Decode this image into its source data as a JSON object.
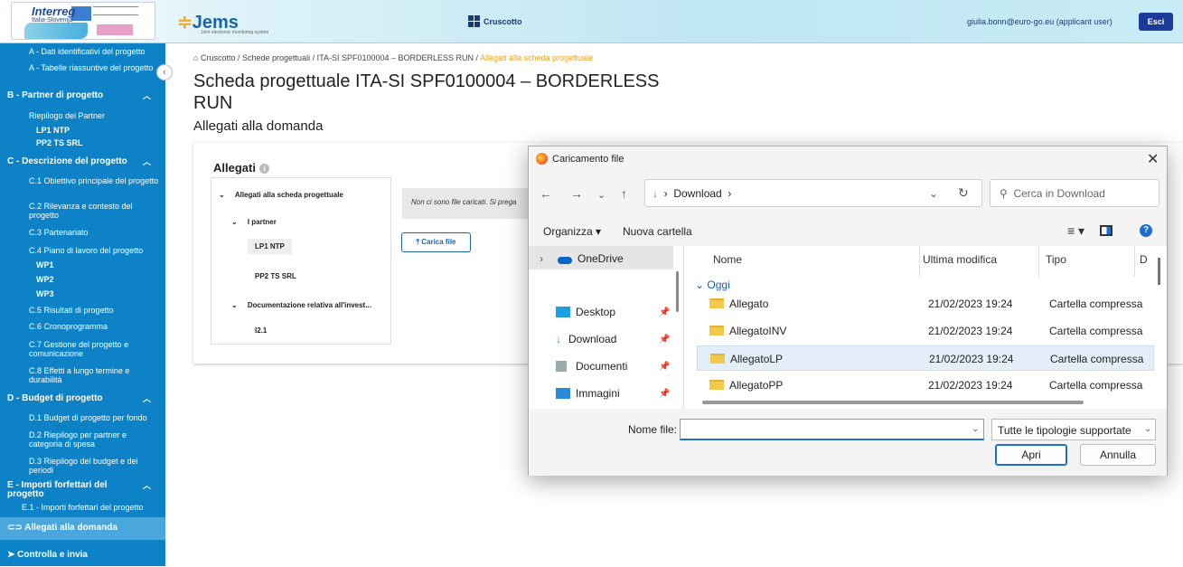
{
  "header": {
    "logo_text": "Interreg",
    "logo_sub": "Italia-Slovenija",
    "app_name": "Jems",
    "app_sub": "Joint electronic monitoring system",
    "dashboard_label": "Cruscotto",
    "user": "giulia.bonn@euro-go.eu (applicant user)",
    "logout": "Esci"
  },
  "sidebar": {
    "items": [
      {
        "label": "A - Dati identificativi del progetto"
      },
      {
        "label": "A - Tabelle riassuntive del progetto"
      },
      {
        "label": "B - Partner di progetto"
      },
      {
        "label": "Riepilogo dei Partner"
      },
      {
        "label": "LP1 NTP"
      },
      {
        "label": "PP2 TS SRL"
      },
      {
        "label": "C - Descrizione del progetto"
      },
      {
        "label": "C.1 Obiettivo principale del progetto"
      },
      {
        "label": "C.2 Rilevanza e contesto del progetto"
      },
      {
        "label": "C.3 Partenariato"
      },
      {
        "label": "C.4 Piano di lavoro del progetto"
      },
      {
        "label": "WP1"
      },
      {
        "label": "WP2"
      },
      {
        "label": "WP3"
      },
      {
        "label": "C.5 Risultati di progetto"
      },
      {
        "label": "C.6 Cronoprogramma"
      },
      {
        "label": "C.7 Gestione del progetto e comunicazione"
      },
      {
        "label": "C.8 Effetti a lungo termine e durabilità"
      },
      {
        "label": "D - Budget di progetto"
      },
      {
        "label": "D.1 Budget di progetto per fondo"
      },
      {
        "label": "D.2 Riepilogo per partner e categoria di spesa"
      },
      {
        "label": "D.3 Riepilogo del budget e dei periodi"
      },
      {
        "label": "E - Importi forfettari del progetto"
      },
      {
        "label": "E.1 - Importi forfettari del progetto"
      },
      {
        "label": "Allegati alla domanda"
      },
      {
        "label": "Controlla e invia"
      }
    ]
  },
  "breadcrumb": {
    "home": "Cruscotto",
    "sep": "/",
    "b2": "Schede progettuali",
    "b3": "ITA-SI SPF0100004 – BORDERLESS RUN",
    "current": "Allegati alla scheda progettuale"
  },
  "page": {
    "title": "Scheda progettuale ITA-SI SPF0100004 – BORDERLESS RUN",
    "subtitle": "Allegati alla domanda"
  },
  "attachments": {
    "heading": "Allegati",
    "tree": {
      "root": "Allegati alla scheda progettuale",
      "partners": "I partner",
      "lp1": "LP1 NTP",
      "pp2": "PP2 TS SRL",
      "invest": "Documentazione relativa all'invest...",
      "i21": "I2.1"
    },
    "empty_msg": "Non ci sono file caricati. Si prega",
    "upload_button": "Carica file"
  },
  "dialog": {
    "title": "Caricamento file",
    "path_current": "Download",
    "search_placeholder": "Cerca in Download",
    "organize": "Organizza",
    "new_folder": "Nuova cartella",
    "nav_items": [
      "OneDrive",
      "Desktop",
      "Download",
      "Documenti",
      "Immagini"
    ],
    "columns": [
      "Nome",
      "Ultima modifica",
      "Tipo",
      "D"
    ],
    "group": "Oggi",
    "files": [
      {
        "name": "Allegato",
        "date": "21/02/2023 19:24",
        "type": "Cartella compressa"
      },
      {
        "name": "AllegatoINV",
        "date": "21/02/2023 19:24",
        "type": "Cartella compressa"
      },
      {
        "name": "AllegatoLP",
        "date": "21/02/2023 19:24",
        "type": "Cartella compressa"
      },
      {
        "name": "AllegatoPP",
        "date": "21/02/2023 19:24",
        "type": "Cartella compressa"
      }
    ],
    "file_name_label": "Nome file:",
    "file_name_value": "",
    "file_type": "Tutte le tipologie supportate",
    "open": "Apri",
    "cancel": "Annulla"
  }
}
